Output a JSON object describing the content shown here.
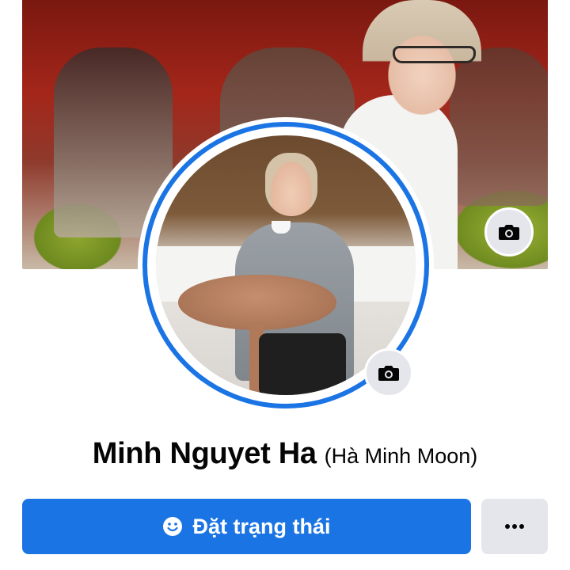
{
  "profile": {
    "name": "Minh Nguyet Ha",
    "alternate_name": "(Hà Minh Moon)"
  },
  "actions": {
    "status_label": "Đặt trạng thái",
    "status_icon": "smile-icon",
    "more_icon": "ellipsis-icon"
  },
  "cover": {
    "camera_icon": "camera-icon"
  },
  "avatar": {
    "camera_icon": "camera-icon",
    "ring_color": "#1b74e4"
  },
  "colors": {
    "primary": "#1b74e4",
    "secondary_bg": "#e4e6eb",
    "text": "#050505"
  }
}
